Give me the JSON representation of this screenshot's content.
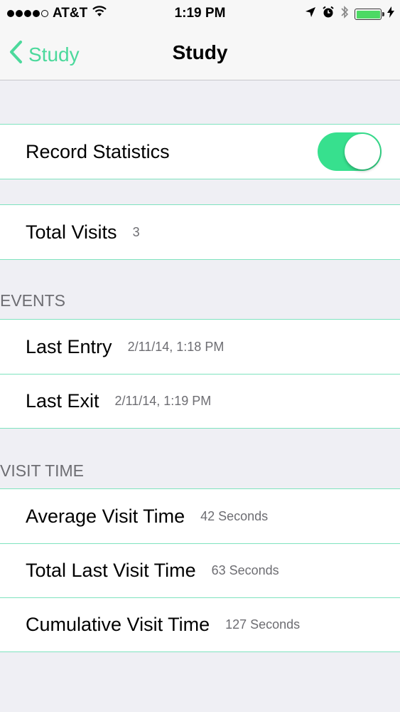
{
  "status_bar": {
    "carrier": "AT&T",
    "time": "1:19 PM",
    "battery_color": "#4cd964"
  },
  "nav": {
    "back_label": "Study",
    "title": "Study",
    "accent_color": "#4cd99c"
  },
  "settings": {
    "record_statistics": {
      "label": "Record Statistics",
      "enabled": true
    },
    "total_visits": {
      "label": "Total Visits",
      "value": "3"
    }
  },
  "events": {
    "header": "EVENTS",
    "last_entry": {
      "label": "Last Entry",
      "value": "2/11/14, 1:18 PM"
    },
    "last_exit": {
      "label": "Last Exit",
      "value": "2/11/14, 1:19 PM"
    }
  },
  "visit_time": {
    "header": "VISIT TIME",
    "average": {
      "label": "Average Visit Time",
      "value": "42 Seconds"
    },
    "total_last": {
      "label": "Total Last Visit Time",
      "value": "63 Seconds"
    },
    "cumulative": {
      "label": "Cumulative Visit Time",
      "value": "127 Seconds"
    }
  },
  "icons": {
    "wifi": "wifi-icon",
    "location": "location-arrow-icon",
    "alarm": "alarm-clock-icon",
    "bluetooth": "bluetooth-icon",
    "battery": "battery-icon",
    "charging": "charging-bolt-icon",
    "back": "chevron-left-icon"
  }
}
